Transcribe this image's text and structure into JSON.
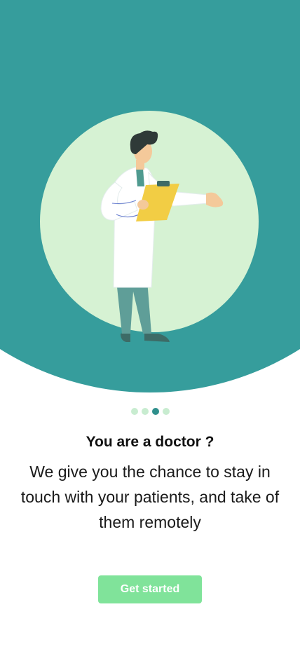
{
  "colors": {
    "hero_bg": "#369d9c",
    "blob": "#d6f2d3",
    "dot_inactive": "#c8ecd0",
    "dot_active": "#2f8f8c",
    "button_bg": "#80e39a",
    "button_text": "#ffffff",
    "coat": "#ffffff",
    "pants": "#5f9e98",
    "clipboard": "#f2cd44",
    "skin": "#f4c99a",
    "hair": "#2f3a38"
  },
  "carousel": {
    "total": 4,
    "active_index": 2
  },
  "onboarding": {
    "title": "You are a doctor ?",
    "subtitle": "We give you the chance to stay in touch with your patients, and take of them remotely"
  },
  "cta": {
    "label": "Get started"
  },
  "illustration": {
    "icon": "doctor-with-clipboard-illustration"
  }
}
